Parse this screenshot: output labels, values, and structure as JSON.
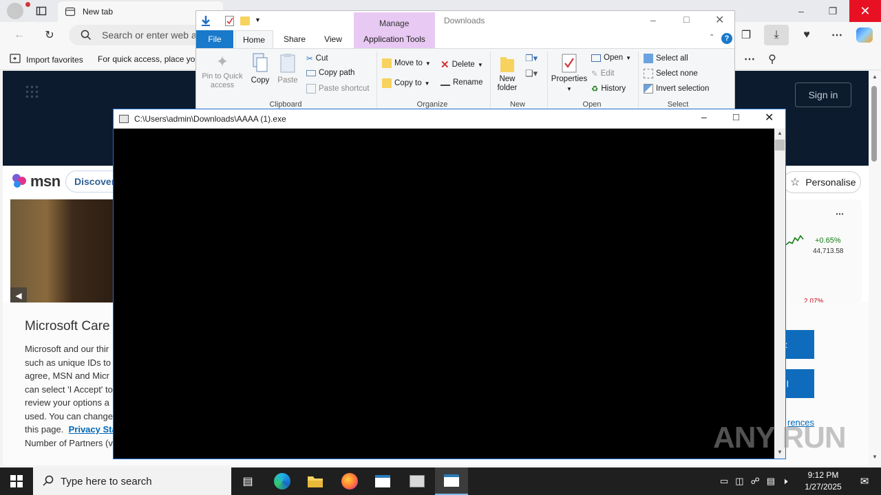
{
  "browser": {
    "tab_title": "New tab",
    "address_placeholder": "Search or enter web a",
    "favorites": {
      "import_label": "Import favorites",
      "hint": "For quick access, place you"
    }
  },
  "msn": {
    "logo_text": "msn",
    "discover_label": "Discover",
    "sign_in_label": "Sign in",
    "personalise_label": "Personalise",
    "stock_change": "+0.65%",
    "stock_value": "44,713.58",
    "stock_change_2": "2.07%",
    "consent_title": "Microsoft Care",
    "consent_lines": [
      "Microsoft and our thir",
      "such as unique IDs to",
      "agree, MSN and Micr",
      "can select 'I Accept' to",
      "review your options a",
      "used. You can change",
      "this page."
    ],
    "privacy_link": "Privacy Sta",
    "partners_line": "Number of Partners (v",
    "preferences_link": "rences",
    "accept_btn_1": "t",
    "accept_btn_2": "ll"
  },
  "explorer": {
    "context_tab": "Manage",
    "window_title": "Downloads",
    "tabs": [
      "File",
      "Home",
      "Share",
      "View",
      "Application Tools"
    ],
    "clipboard": {
      "pin_label": "Pin to Quick access",
      "copy_label": "Copy",
      "paste_label": "Paste",
      "cut_label": "Cut",
      "copy_path_label": "Copy path",
      "paste_shortcut_label": "Paste shortcut",
      "group_label": "Clipboard"
    },
    "organize": {
      "move_to_label": "Move to",
      "copy_to_label": "Copy to",
      "delete_label": "Delete",
      "rename_label": "Rename",
      "group_label": "Organize"
    },
    "new": {
      "new_folder_label": "New folder",
      "group_label": "New"
    },
    "open": {
      "properties_label": "Properties",
      "open_label": "Open",
      "edit_label": "Edit",
      "history_label": "History",
      "group_label": "Open"
    },
    "select": {
      "select_all_label": "Select all",
      "select_none_label": "Select none",
      "invert_label": "Invert selection",
      "group_label": "Select"
    }
  },
  "console": {
    "title": "C:\\Users\\admin\\Downloads\\AAAA (1).exe"
  },
  "taskbar": {
    "search_placeholder": "Type here to search",
    "time": "9:12 PM",
    "date": "1/27/2025"
  },
  "watermark": "ANY RUN",
  "colors": {
    "accent": "#0067c0",
    "manage_tab": "#e8c9f3",
    "console_bg": "#000000",
    "taskbar_bg": "#1f1f1f",
    "close_red": "#e81123"
  }
}
